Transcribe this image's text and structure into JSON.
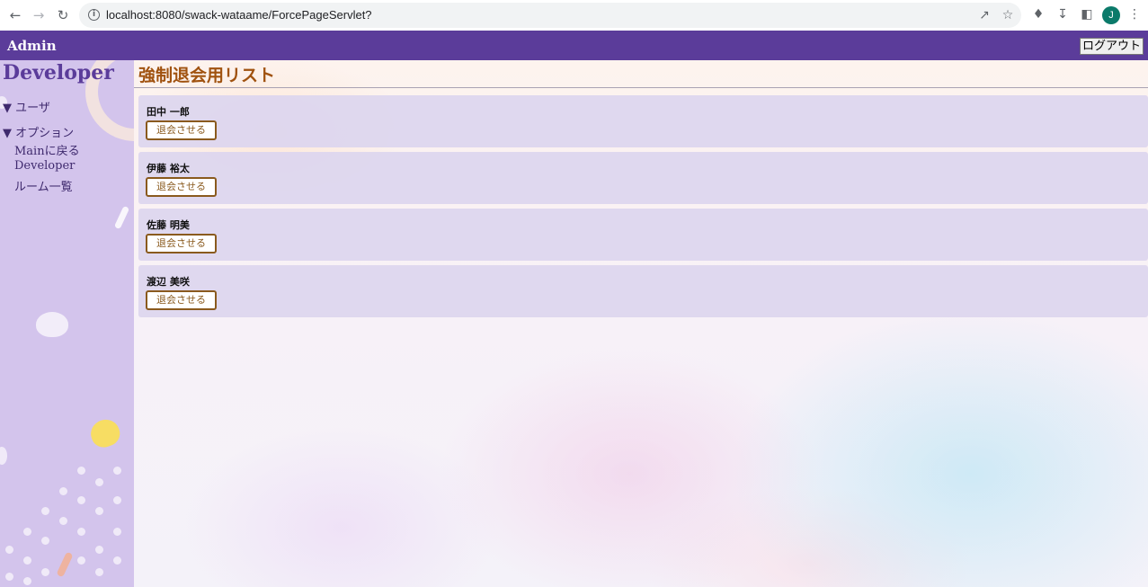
{
  "browser": {
    "url": "localhost:8080/swack-wataame/ForcePageServlet?",
    "profile_initial": "J"
  },
  "header": {
    "app_title": "Admin",
    "logout_label": "ログアウト"
  },
  "sidebar": {
    "title": "Developer",
    "sections": [
      {
        "label": "▼ ユーザ"
      },
      {
        "label": "▼ オプション"
      }
    ],
    "links": [
      {
        "label": "Mainに戻る"
      },
      {
        "label": "Developer"
      },
      {
        "label": "ルーム一覧"
      }
    ]
  },
  "main": {
    "title": "強制退会用リスト",
    "users": [
      {
        "name": "田中 一郎",
        "button": "退会させる"
      },
      {
        "name": "伊藤 裕太",
        "button": "退会させる"
      },
      {
        "name": "佐藤 明美",
        "button": "退会させる"
      },
      {
        "name": "渡辺 美咲",
        "button": "退会させる"
      }
    ]
  },
  "colors": {
    "header_bg": "#5b3c9a",
    "sidebar_bg": "#d3c4ec",
    "title_color": "#a0520f",
    "card_bg": "#ddd6ee"
  }
}
